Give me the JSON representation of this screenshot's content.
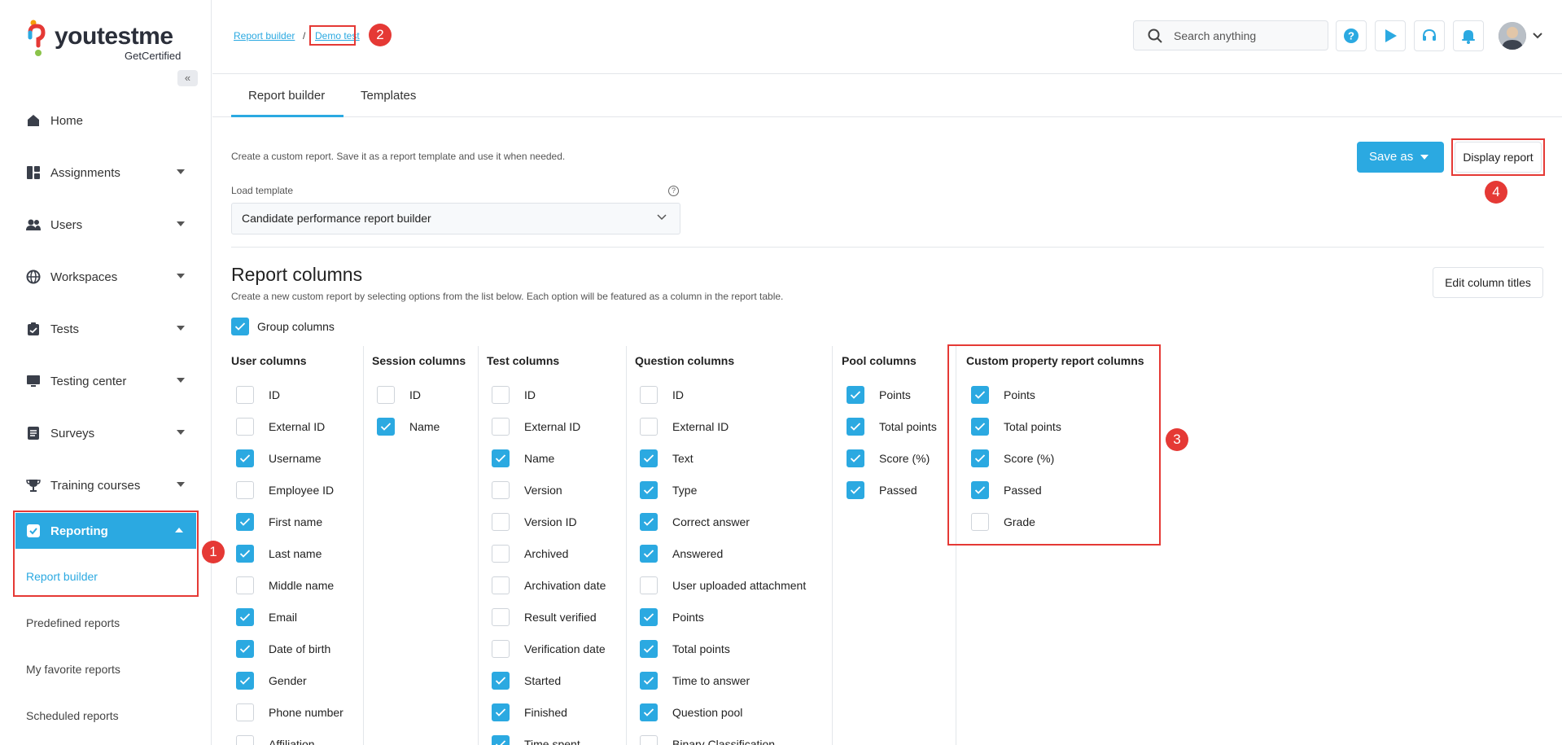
{
  "brand": {
    "name": "youtestme",
    "sub": "GetCertified"
  },
  "sidebar": {
    "collapse_icon": "«",
    "items": [
      {
        "label": "Home",
        "icon": "home-icon",
        "caret": false
      },
      {
        "label": "Assignments",
        "icon": "dashboard-icon",
        "caret": true
      },
      {
        "label": "Users",
        "icon": "users-icon",
        "caret": true
      },
      {
        "label": "Workspaces",
        "icon": "globe-icon",
        "caret": true
      },
      {
        "label": "Tests",
        "icon": "clipboard-icon",
        "caret": true
      },
      {
        "label": "Testing center",
        "icon": "monitor-icon",
        "caret": true
      },
      {
        "label": "Surveys",
        "icon": "list-icon",
        "caret": true
      },
      {
        "label": "Training courses",
        "icon": "trophy-icon",
        "caret": true
      }
    ],
    "reporting": {
      "label": "Reporting",
      "subitems": [
        "Report builder",
        "Predefined reports",
        "My favorite reports",
        "Scheduled reports"
      ]
    }
  },
  "breadcrumb": {
    "root": "Report builder",
    "separator": "/",
    "current": "Demo test"
  },
  "header": {
    "search_placeholder": "Search anything"
  },
  "tabs": [
    "Report builder",
    "Templates"
  ],
  "content": {
    "description": "Create a custom report. Save it as a report template and use it when needed.",
    "save_as": "Save as",
    "display_report": "Display report",
    "load_template_label": "Load template",
    "load_template_value": "Candidate performance report builder",
    "report_columns_title": "Report columns",
    "report_columns_desc": "Create a new custom report by selecting options from the list below. Each option will be featured as a column in the report table.",
    "edit_column_titles": "Edit column titles",
    "group_columns": "Group columns",
    "group_columns_checked": true
  },
  "columns": {
    "user": {
      "title": "User columns",
      "items": [
        {
          "label": "ID",
          "checked": false
        },
        {
          "label": "External ID",
          "checked": false
        },
        {
          "label": "Username",
          "checked": true
        },
        {
          "label": "Employee ID",
          "checked": false
        },
        {
          "label": "First name",
          "checked": true
        },
        {
          "label": "Last name",
          "checked": true
        },
        {
          "label": "Middle name",
          "checked": false
        },
        {
          "label": "Email",
          "checked": true
        },
        {
          "label": "Date of birth",
          "checked": true
        },
        {
          "label": "Gender",
          "checked": true
        },
        {
          "label": "Phone number",
          "checked": false
        },
        {
          "label": "Affiliation",
          "checked": false
        }
      ]
    },
    "session": {
      "title": "Session columns",
      "items": [
        {
          "label": "ID",
          "checked": false
        },
        {
          "label": "Name",
          "checked": true
        }
      ]
    },
    "test": {
      "title": "Test columns",
      "items": [
        {
          "label": "ID",
          "checked": false
        },
        {
          "label": "External ID",
          "checked": false
        },
        {
          "label": "Name",
          "checked": true
        },
        {
          "label": "Version",
          "checked": false
        },
        {
          "label": "Version ID",
          "checked": false
        },
        {
          "label": "Archived",
          "checked": false
        },
        {
          "label": "Archivation date",
          "checked": false
        },
        {
          "label": "Result verified",
          "checked": false
        },
        {
          "label": "Verification date",
          "checked": false
        },
        {
          "label": "Started",
          "checked": true
        },
        {
          "label": "Finished",
          "checked": true
        },
        {
          "label": "Time spent",
          "checked": true
        }
      ]
    },
    "question": {
      "title": "Question columns",
      "items": [
        {
          "label": "ID",
          "checked": false
        },
        {
          "label": "External ID",
          "checked": false
        },
        {
          "label": "Text",
          "checked": true
        },
        {
          "label": "Type",
          "checked": true
        },
        {
          "label": "Correct answer",
          "checked": true
        },
        {
          "label": "Answered",
          "checked": true
        },
        {
          "label": "User uploaded attachment",
          "checked": false
        },
        {
          "label": "Points",
          "checked": true
        },
        {
          "label": "Total points",
          "checked": true
        },
        {
          "label": "Time to answer",
          "checked": true
        },
        {
          "label": "Question pool",
          "checked": true
        },
        {
          "label": "Binary Classification",
          "checked": false
        }
      ]
    },
    "pool": {
      "title": "Pool columns",
      "items": [
        {
          "label": "Points",
          "checked": true
        },
        {
          "label": "Total points",
          "checked": true
        },
        {
          "label": "Score (%)",
          "checked": true
        },
        {
          "label": "Passed",
          "checked": true
        }
      ]
    },
    "custom": {
      "title": "Custom property report columns",
      "items": [
        {
          "label": "Points",
          "checked": true
        },
        {
          "label": "Total points",
          "checked": true
        },
        {
          "label": "Score (%)",
          "checked": true
        },
        {
          "label": "Passed",
          "checked": true
        },
        {
          "label": "Grade",
          "checked": false
        }
      ]
    }
  },
  "annotations": [
    "1",
    "2",
    "3",
    "4"
  ],
  "colors": {
    "accent": "#2ba9e1",
    "highlight": "#e53935"
  }
}
